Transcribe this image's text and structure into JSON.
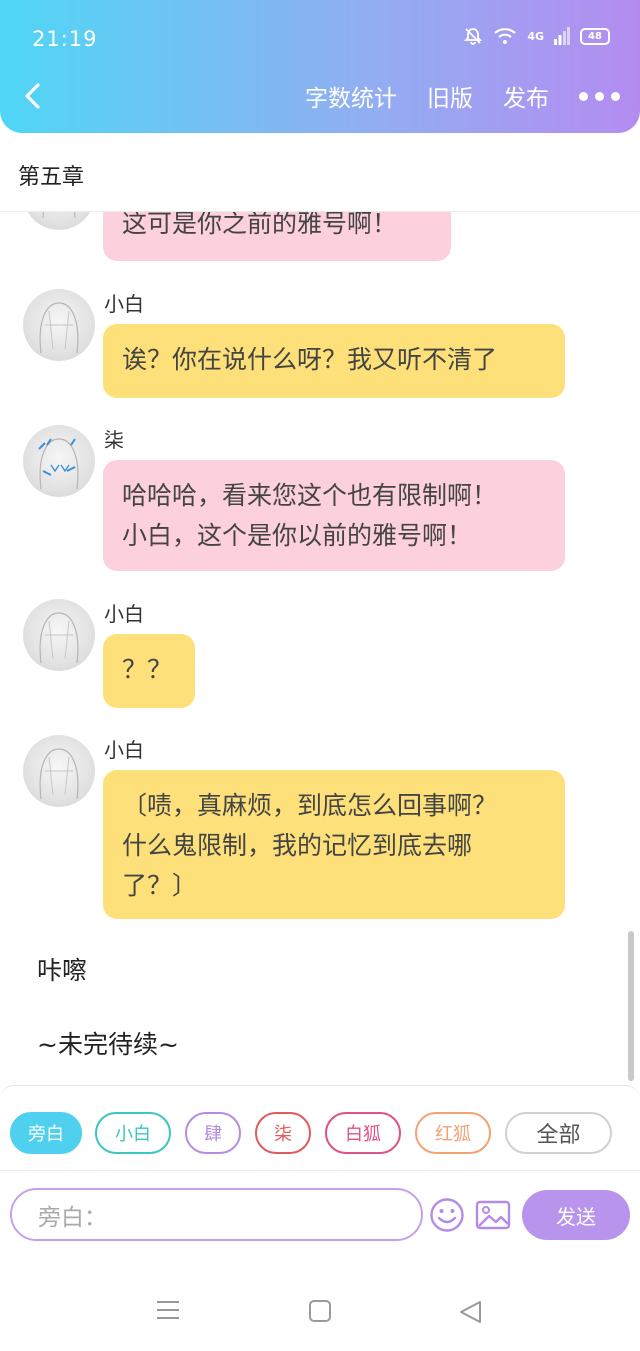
{
  "status_bar": {
    "time": "21:19",
    "network": "4G",
    "battery": "48"
  },
  "header": {
    "actions": [
      "字数统计",
      "旧版",
      "发布"
    ]
  },
  "chapter_title": "第五章",
  "messages": [
    {
      "speaker": "",
      "text": "这可是你之前的雅号啊！",
      "color": "pink"
    },
    {
      "speaker": "小白",
      "text": "诶？你在说什么呀？我又听不清了",
      "color": "yellow"
    },
    {
      "speaker": "柒",
      "text": "哈哈哈，看来您这个也有限制啊！\n小白，这个是你以前的雅号啊！",
      "color": "pink"
    },
    {
      "speaker": "小白",
      "text": "？？",
      "color": "yellow"
    },
    {
      "speaker": "小白",
      "text": "〔啧，真麻烦，到底怎么回事啊？\n什么鬼限制，我的记忆到底去哪\n了？〕",
      "color": "yellow"
    }
  ],
  "narration": [
    "咔嚓",
    "~未完待续~"
  ],
  "role_chips": [
    {
      "label": "旁白",
      "color": "#4fd0ee",
      "selected": true
    },
    {
      "label": "小白",
      "color": "#3cc6c0",
      "selected": false
    },
    {
      "label": "肆",
      "color": "#b68ce0",
      "selected": false
    },
    {
      "label": "柒",
      "color": "#e25b5b",
      "selected": false
    },
    {
      "label": "白狐",
      "color": "#e0508a",
      "selected": false
    },
    {
      "label": "红狐",
      "color": "#f2a374",
      "selected": false
    },
    {
      "label": "全部",
      "color": "#cccccc",
      "selected": false
    }
  ],
  "composer": {
    "placeholder": "旁白：",
    "send_label": "发送"
  },
  "colors": {
    "pink_bubble": "#fcd0dc",
    "yellow_bubble": "#fde07a",
    "accent": "#b994ec"
  },
  "icons": [
    "back-icon",
    "more-icon",
    "emoji-icon",
    "image-icon",
    "menu-icon",
    "home-icon",
    "back-triangle-icon"
  ]
}
